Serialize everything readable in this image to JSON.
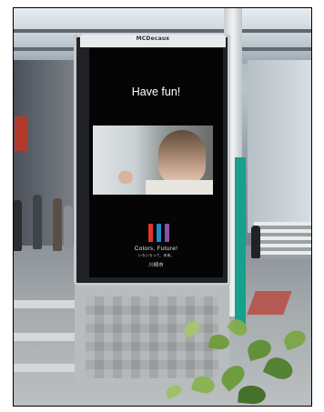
{
  "kiosk": {
    "brand": "MCDecaux",
    "headline": "Have fun!",
    "logo_title": "Colors, Future!",
    "logo_subtitle": "いろいろって、未来。",
    "city": "川崎市",
    "logo_colors": [
      "#e0342f",
      "#1e88c8",
      "#8b4fa8"
    ]
  }
}
